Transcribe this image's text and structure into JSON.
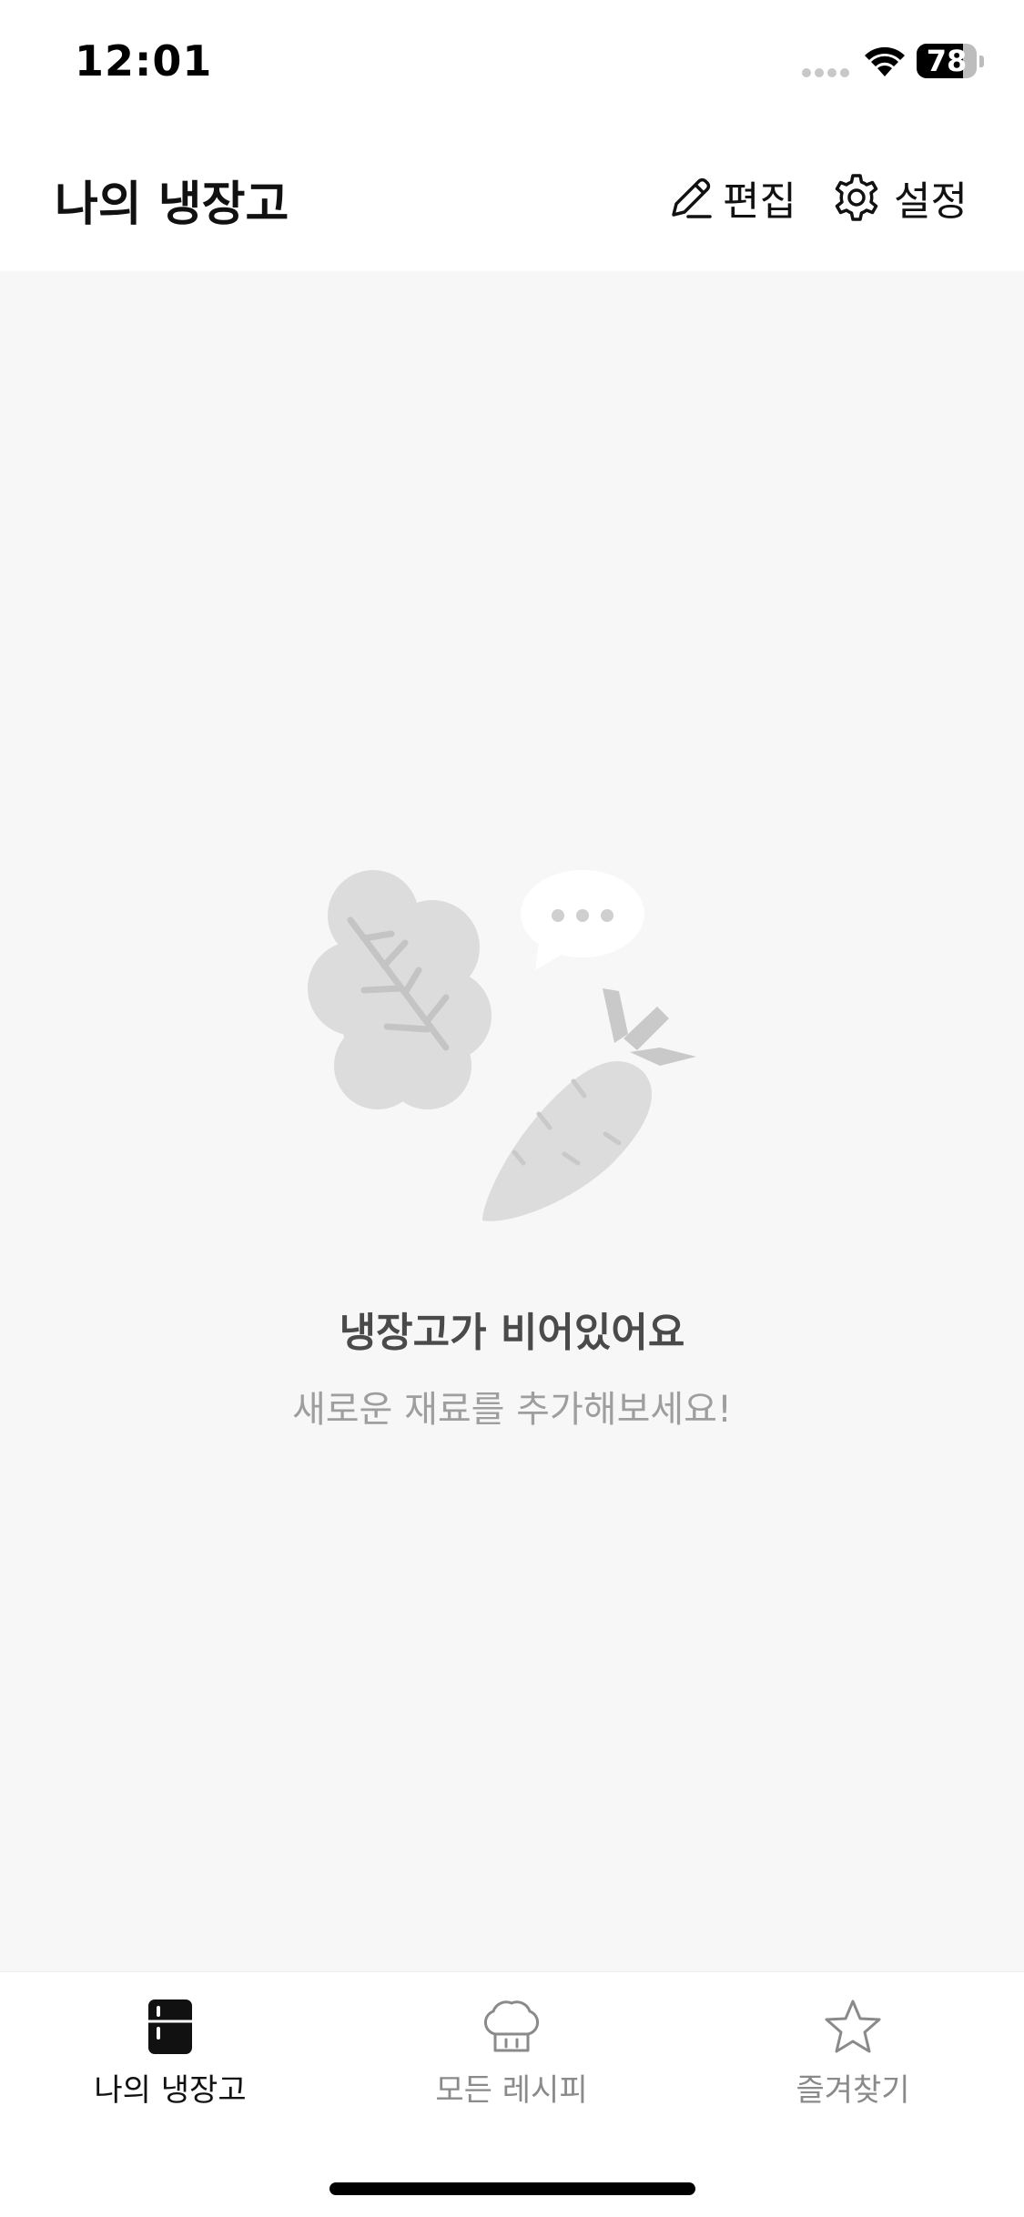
{
  "status_bar": {
    "time": "12:01",
    "battery_percent": 78,
    "battery_label": "78"
  },
  "header": {
    "title": "나의 냉장고",
    "edit_label": "편집",
    "settings_label": "설정"
  },
  "empty_state": {
    "title": "냉장고가 비어있어요",
    "subtitle": "새로운 재료를 추가해보세요!"
  },
  "tabs": [
    {
      "label": "나의 냉장고",
      "icon": "fridge-icon",
      "active": true
    },
    {
      "label": "모든 레시피",
      "icon": "chef-hat-icon",
      "active": false
    },
    {
      "label": "즐겨찾기",
      "icon": "star-icon",
      "active": false
    }
  ],
  "colors": {
    "background": "#f7f7f7",
    "active_tab": "#111111",
    "inactive_tab": "#8a8a8a",
    "illustration": "#dcdcdc"
  }
}
